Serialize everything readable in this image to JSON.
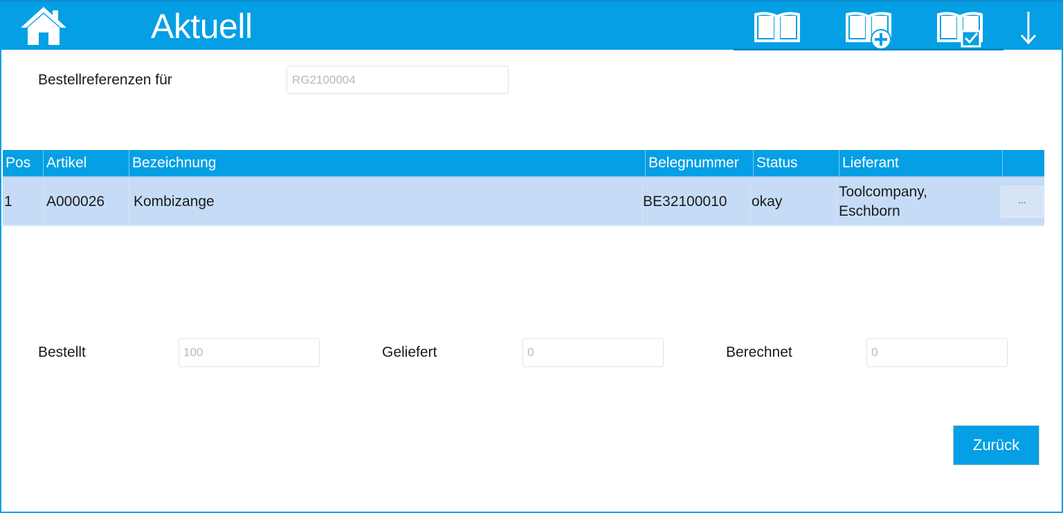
{
  "header": {
    "title": "Aktuell",
    "home_icon": "home-icon",
    "tools": [
      {
        "name": "book-open-icon"
      },
      {
        "name": "book-add-icon"
      },
      {
        "name": "book-check-icon"
      },
      {
        "name": "arrow-down-icon"
      }
    ],
    "background_color": "#049fe4"
  },
  "reference": {
    "label": "Bestellreferenzen für",
    "value": "RG2100004"
  },
  "table": {
    "columns": [
      "Pos",
      "Artikel",
      "Bezeichnung",
      "Belegnummer",
      "Status",
      "Lieferant",
      ""
    ],
    "rows": [
      {
        "pos": "1",
        "artikel": "A000026",
        "bezeichnung": "Kombizange",
        "belegnummer": "BE32100010",
        "status": "okay",
        "lieferant_line1": "Toolcompany,",
        "lieferant_line2": "Eschborn",
        "action_label": "..."
      }
    ],
    "row_highlight_color": "#c6dcf6"
  },
  "quantities": {
    "bestellt_label": "Bestellt",
    "bestellt_value": "100",
    "geliefert_label": "Geliefert",
    "geliefert_value": "0",
    "berechnet_label": "Berechnet",
    "berechnet_value": "0"
  },
  "footer": {
    "back_label": "Zurück"
  }
}
